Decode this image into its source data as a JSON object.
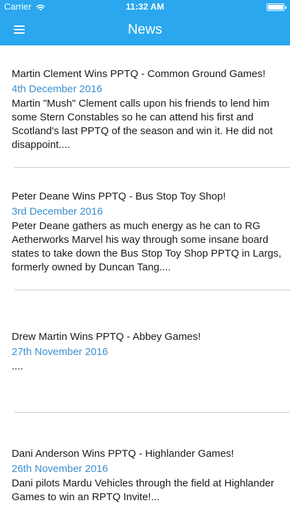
{
  "status_bar": {
    "carrier": "Carrier",
    "time": "11:32 AM",
    "wifi_icon": "wifi-icon",
    "battery_icon": "battery-icon"
  },
  "nav_bar": {
    "title": "News",
    "menu_icon": "hamburger-menu-icon",
    "background_color": "#2aa7ee"
  },
  "articles": [
    {
      "title": "Martin Clement Wins PPTQ - Common Ground Games!",
      "date": "4th December 2016",
      "summary": "Martin \"Mush\" Clement calls upon his friends to lend him some Stern Constables so he can attend his first and Scotland's last PPTQ of the season and win it. He did not disappoint...."
    },
    {
      "title": "Peter Deane Wins PPTQ - Bus Stop Toy Shop!",
      "date": "3rd December 2016",
      "summary": "Peter Deane gathers as much energy as he can to RG Aetherworks Marvel his way through some insane board states to take down the Bus Stop Toy Shop PPTQ in Largs, formerly owned by Duncan Tang...."
    },
    {
      "title": "Drew Martin Wins PPTQ - Abbey Games!",
      "date": "27th November 2016",
      "summary": "...."
    },
    {
      "title": "Dani Anderson Wins PPTQ - Highlander Games!",
      "date": "26th November 2016",
      "summary": "Dani pilots Mardu Vehicles through the field at Highlander Games to win an RPTQ Invite!..."
    }
  ],
  "colors": {
    "accent": "#2aa7ee",
    "date_text": "#3a8fd1",
    "divider": "#cfcfcf"
  }
}
